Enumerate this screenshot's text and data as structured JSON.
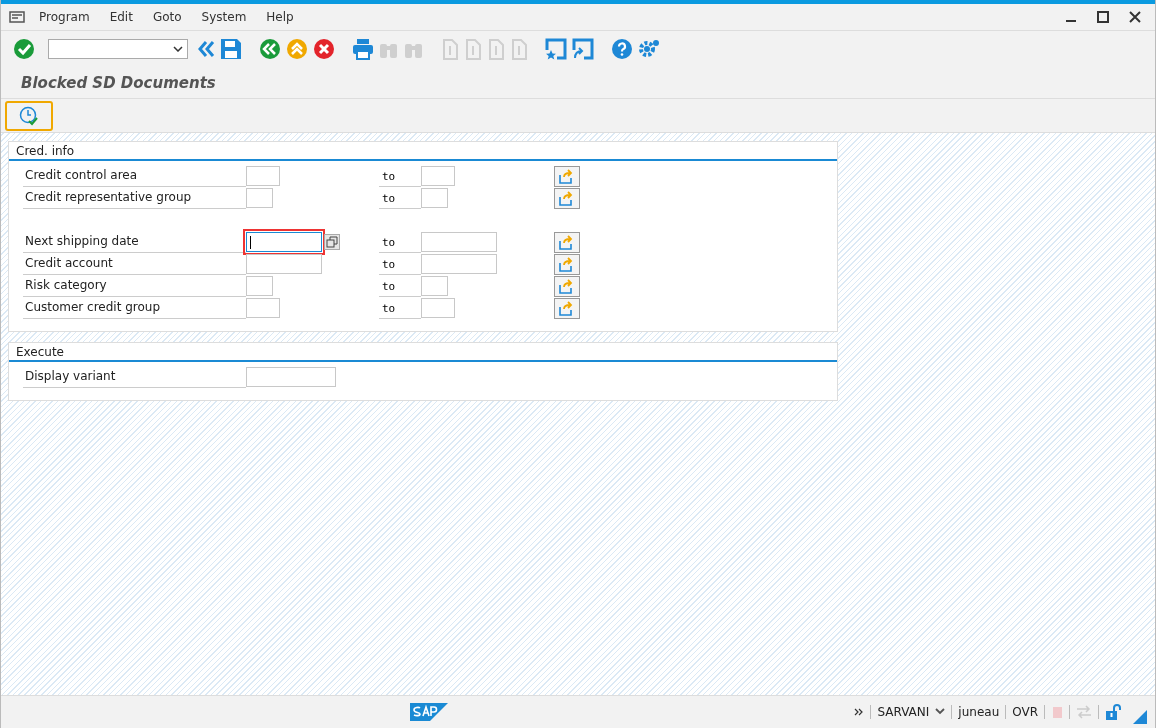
{
  "menu": [
    "Program",
    "Edit",
    "Goto",
    "System",
    "Help"
  ],
  "toolbar": [
    {
      "kind": "enter",
      "disabled": false
    },
    {
      "kind": "command-field",
      "disabled": false
    },
    {
      "kind": "collapse",
      "disabled": false
    },
    {
      "kind": "save",
      "disabled": false
    },
    {
      "kind": "back",
      "disabled": false
    },
    {
      "kind": "exit",
      "disabled": false
    },
    {
      "kind": "cancel",
      "disabled": false
    },
    {
      "kind": "print",
      "disabled": false
    },
    {
      "kind": "find",
      "disabled": true
    },
    {
      "kind": "find-next",
      "disabled": true
    },
    {
      "kind": "first-page",
      "disabled": true
    },
    {
      "kind": "prev-page",
      "disabled": true
    },
    {
      "kind": "next-page",
      "disabled": true
    },
    {
      "kind": "last-page",
      "disabled": true
    },
    {
      "kind": "new-session",
      "disabled": false
    },
    {
      "kind": "shortcut",
      "disabled": false
    },
    {
      "kind": "help",
      "disabled": false
    },
    {
      "kind": "settings",
      "disabled": false
    }
  ],
  "title": "Blocked SD Documents",
  "app_toolbar": [
    {
      "kind": "execute",
      "selected": true
    }
  ],
  "sections": [
    {
      "title": "Cred. info",
      "rows": [
        {
          "label": "Credit control area",
          "kind": "short",
          "to": "to",
          "focused": false
        },
        {
          "label": "Credit representative group",
          "kind": "tiny",
          "to": "to",
          "focused": false
        },
        {
          "kind": "spacer"
        },
        {
          "label": "Next shipping date",
          "kind": "date",
          "to": "to",
          "focused": true
        },
        {
          "label": "Credit account",
          "kind": "account",
          "to": "to",
          "focused": false
        },
        {
          "label": "Risk category",
          "kind": "tiny",
          "to": "to",
          "focused": false
        },
        {
          "label": "Customer credit group",
          "kind": "short",
          "to": "to",
          "focused": false
        }
      ]
    },
    {
      "title": "Execute",
      "rows": [
        {
          "label": "Display variant",
          "kind": "variant",
          "focused": false
        }
      ]
    }
  ],
  "status_bar": {
    "system": "SARVANI",
    "client": "juneau",
    "mode": "OVR"
  }
}
